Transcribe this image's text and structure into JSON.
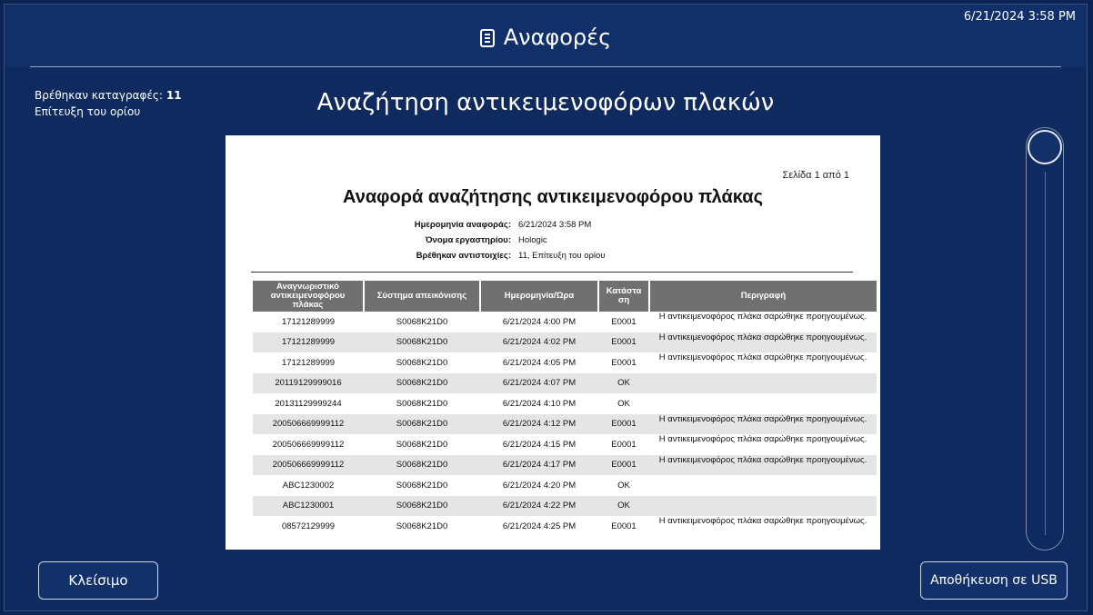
{
  "header": {
    "title": "Αναφορές",
    "datetime": "6/21/2024 3:58 PM"
  },
  "stats": {
    "found_label": "Βρέθηκαν καταγραφές:",
    "found_value": "11",
    "limit_text": "Επίτευξη του ορίου"
  },
  "page_title": "Αναζήτηση αντικειμενοφόρων πλακών",
  "report": {
    "page_info": "Σελίδα 1 από 1",
    "title": "Αναφορά αναζήτησης αντικειμενοφόρου πλάκας",
    "meta": [
      {
        "key": "Ημερομηνία αναφοράς:",
        "value": "6/21/2024 3:58 PM"
      },
      {
        "key": "Όνομα εργαστηρίου:",
        "value": "Hologic"
      },
      {
        "key": "Βρέθηκαν αντιστοιχίες:",
        "value": "11, Επίτευξη του ορίου"
      }
    ],
    "columns": [
      "Αναγνωριστικό αντικειμενοφόρου πλάκας",
      "Σύστημα απεικόνισης",
      "Ημερομηνία/Ώρα",
      "Κατάστα ση",
      "Περιγραφή"
    ],
    "rows": [
      {
        "id": "17121289999",
        "system": "S0068K21D0",
        "datetime": "6/21/2024 4:00 PM",
        "status": "E0001",
        "description": "Η αντικειμενοφόρος πλάκα σαρώθηκε προηγουμένως."
      },
      {
        "id": "17121289999",
        "system": "S0068K21D0",
        "datetime": "6/21/2024 4:02 PM",
        "status": "E0001",
        "description": "Η αντικειμενοφόρος πλάκα σαρώθηκε προηγουμένως."
      },
      {
        "id": "17121289999",
        "system": "S0068K21D0",
        "datetime": "6/21/2024 4:05 PM",
        "status": "E0001",
        "description": "Η αντικειμενοφόρος πλάκα σαρώθηκε προηγουμένως."
      },
      {
        "id": "20119129999016",
        "system": "S0068K21D0",
        "datetime": "6/21/2024 4:07 PM",
        "status": "OK",
        "description": ""
      },
      {
        "id": "20131129999244",
        "system": "S0068K21D0",
        "datetime": "6/21/2024 4:10 PM",
        "status": "OK",
        "description": ""
      },
      {
        "id": "200506669999112",
        "system": "S0068K21D0",
        "datetime": "6/21/2024 4:12 PM",
        "status": "E0001",
        "description": "Η αντικειμενοφόρος πλάκα σαρώθηκε προηγουμένως."
      },
      {
        "id": "200506669999112",
        "system": "S0068K21D0",
        "datetime": "6/21/2024 4:15 PM",
        "status": "E0001",
        "description": "Η αντικειμενοφόρος πλάκα σαρώθηκε προηγουμένως."
      },
      {
        "id": "200506669999112",
        "system": "S0068K21D0",
        "datetime": "6/21/2024 4:17 PM",
        "status": "E0001",
        "description": "Η αντικειμενοφόρος πλάκα σαρώθηκε προηγουμένως."
      },
      {
        "id": "ABC1230002",
        "system": "S0068K21D0",
        "datetime": "6/21/2024 4:20 PM",
        "status": "OK",
        "description": ""
      },
      {
        "id": "ABC1230001",
        "system": "S0068K21D0",
        "datetime": "6/21/2024 4:22 PM",
        "status": "OK",
        "description": ""
      },
      {
        "id": "08572129999",
        "system": "S0068K21D0",
        "datetime": "6/21/2024 4:25 PM",
        "status": "E0001",
        "description": "Η αντικειμενοφόρος πλάκα σαρώθηκε προηγουμένως."
      }
    ]
  },
  "buttons": {
    "close": "Κλείσιμο",
    "save_usb": "Αποθήκευση σε USB"
  },
  "icons": {
    "header_icon": "document-list-icon"
  },
  "colors": {
    "background": "#0f2a5e",
    "header": "#11306a",
    "table_header": "#707070",
    "row_alt": "#e5e5e5"
  }
}
